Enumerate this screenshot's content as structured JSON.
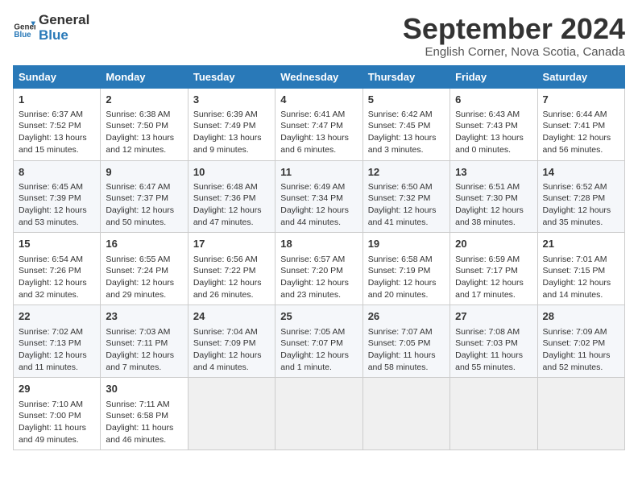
{
  "header": {
    "logo_general": "General",
    "logo_blue": "Blue",
    "month": "September 2024",
    "location": "English Corner, Nova Scotia, Canada"
  },
  "days_of_week": [
    "Sunday",
    "Monday",
    "Tuesday",
    "Wednesday",
    "Thursday",
    "Friday",
    "Saturday"
  ],
  "weeks": [
    [
      {
        "day": "1",
        "lines": [
          "Sunrise: 6:37 AM",
          "Sunset: 7:52 PM",
          "Daylight: 13 hours",
          "and 15 minutes."
        ]
      },
      {
        "day": "2",
        "lines": [
          "Sunrise: 6:38 AM",
          "Sunset: 7:50 PM",
          "Daylight: 13 hours",
          "and 12 minutes."
        ]
      },
      {
        "day": "3",
        "lines": [
          "Sunrise: 6:39 AM",
          "Sunset: 7:49 PM",
          "Daylight: 13 hours",
          "and 9 minutes."
        ]
      },
      {
        "day": "4",
        "lines": [
          "Sunrise: 6:41 AM",
          "Sunset: 7:47 PM",
          "Daylight: 13 hours",
          "and 6 minutes."
        ]
      },
      {
        "day": "5",
        "lines": [
          "Sunrise: 6:42 AM",
          "Sunset: 7:45 PM",
          "Daylight: 13 hours",
          "and 3 minutes."
        ]
      },
      {
        "day": "6",
        "lines": [
          "Sunrise: 6:43 AM",
          "Sunset: 7:43 PM",
          "Daylight: 13 hours",
          "and 0 minutes."
        ]
      },
      {
        "day": "7",
        "lines": [
          "Sunrise: 6:44 AM",
          "Sunset: 7:41 PM",
          "Daylight: 12 hours",
          "and 56 minutes."
        ]
      }
    ],
    [
      {
        "day": "8",
        "lines": [
          "Sunrise: 6:45 AM",
          "Sunset: 7:39 PM",
          "Daylight: 12 hours",
          "and 53 minutes."
        ]
      },
      {
        "day": "9",
        "lines": [
          "Sunrise: 6:47 AM",
          "Sunset: 7:37 PM",
          "Daylight: 12 hours",
          "and 50 minutes."
        ]
      },
      {
        "day": "10",
        "lines": [
          "Sunrise: 6:48 AM",
          "Sunset: 7:36 PM",
          "Daylight: 12 hours",
          "and 47 minutes."
        ]
      },
      {
        "day": "11",
        "lines": [
          "Sunrise: 6:49 AM",
          "Sunset: 7:34 PM",
          "Daylight: 12 hours",
          "and 44 minutes."
        ]
      },
      {
        "day": "12",
        "lines": [
          "Sunrise: 6:50 AM",
          "Sunset: 7:32 PM",
          "Daylight: 12 hours",
          "and 41 minutes."
        ]
      },
      {
        "day": "13",
        "lines": [
          "Sunrise: 6:51 AM",
          "Sunset: 7:30 PM",
          "Daylight: 12 hours",
          "and 38 minutes."
        ]
      },
      {
        "day": "14",
        "lines": [
          "Sunrise: 6:52 AM",
          "Sunset: 7:28 PM",
          "Daylight: 12 hours",
          "and 35 minutes."
        ]
      }
    ],
    [
      {
        "day": "15",
        "lines": [
          "Sunrise: 6:54 AM",
          "Sunset: 7:26 PM",
          "Daylight: 12 hours",
          "and 32 minutes."
        ]
      },
      {
        "day": "16",
        "lines": [
          "Sunrise: 6:55 AM",
          "Sunset: 7:24 PM",
          "Daylight: 12 hours",
          "and 29 minutes."
        ]
      },
      {
        "day": "17",
        "lines": [
          "Sunrise: 6:56 AM",
          "Sunset: 7:22 PM",
          "Daylight: 12 hours",
          "and 26 minutes."
        ]
      },
      {
        "day": "18",
        "lines": [
          "Sunrise: 6:57 AM",
          "Sunset: 7:20 PM",
          "Daylight: 12 hours",
          "and 23 minutes."
        ]
      },
      {
        "day": "19",
        "lines": [
          "Sunrise: 6:58 AM",
          "Sunset: 7:19 PM",
          "Daylight: 12 hours",
          "and 20 minutes."
        ]
      },
      {
        "day": "20",
        "lines": [
          "Sunrise: 6:59 AM",
          "Sunset: 7:17 PM",
          "Daylight: 12 hours",
          "and 17 minutes."
        ]
      },
      {
        "day": "21",
        "lines": [
          "Sunrise: 7:01 AM",
          "Sunset: 7:15 PM",
          "Daylight: 12 hours",
          "and 14 minutes."
        ]
      }
    ],
    [
      {
        "day": "22",
        "lines": [
          "Sunrise: 7:02 AM",
          "Sunset: 7:13 PM",
          "Daylight: 12 hours",
          "and 11 minutes."
        ]
      },
      {
        "day": "23",
        "lines": [
          "Sunrise: 7:03 AM",
          "Sunset: 7:11 PM",
          "Daylight: 12 hours",
          "and 7 minutes."
        ]
      },
      {
        "day": "24",
        "lines": [
          "Sunrise: 7:04 AM",
          "Sunset: 7:09 PM",
          "Daylight: 12 hours",
          "and 4 minutes."
        ]
      },
      {
        "day": "25",
        "lines": [
          "Sunrise: 7:05 AM",
          "Sunset: 7:07 PM",
          "Daylight: 12 hours",
          "and 1 minute."
        ]
      },
      {
        "day": "26",
        "lines": [
          "Sunrise: 7:07 AM",
          "Sunset: 7:05 PM",
          "Daylight: 11 hours",
          "and 58 minutes."
        ]
      },
      {
        "day": "27",
        "lines": [
          "Sunrise: 7:08 AM",
          "Sunset: 7:03 PM",
          "Daylight: 11 hours",
          "and 55 minutes."
        ]
      },
      {
        "day": "28",
        "lines": [
          "Sunrise: 7:09 AM",
          "Sunset: 7:02 PM",
          "Daylight: 11 hours",
          "and 52 minutes."
        ]
      }
    ],
    [
      {
        "day": "29",
        "lines": [
          "Sunrise: 7:10 AM",
          "Sunset: 7:00 PM",
          "Daylight: 11 hours",
          "and 49 minutes."
        ]
      },
      {
        "day": "30",
        "lines": [
          "Sunrise: 7:11 AM",
          "Sunset: 6:58 PM",
          "Daylight: 11 hours",
          "and 46 minutes."
        ]
      },
      {
        "day": "",
        "lines": []
      },
      {
        "day": "",
        "lines": []
      },
      {
        "day": "",
        "lines": []
      },
      {
        "day": "",
        "lines": []
      },
      {
        "day": "",
        "lines": []
      }
    ]
  ]
}
